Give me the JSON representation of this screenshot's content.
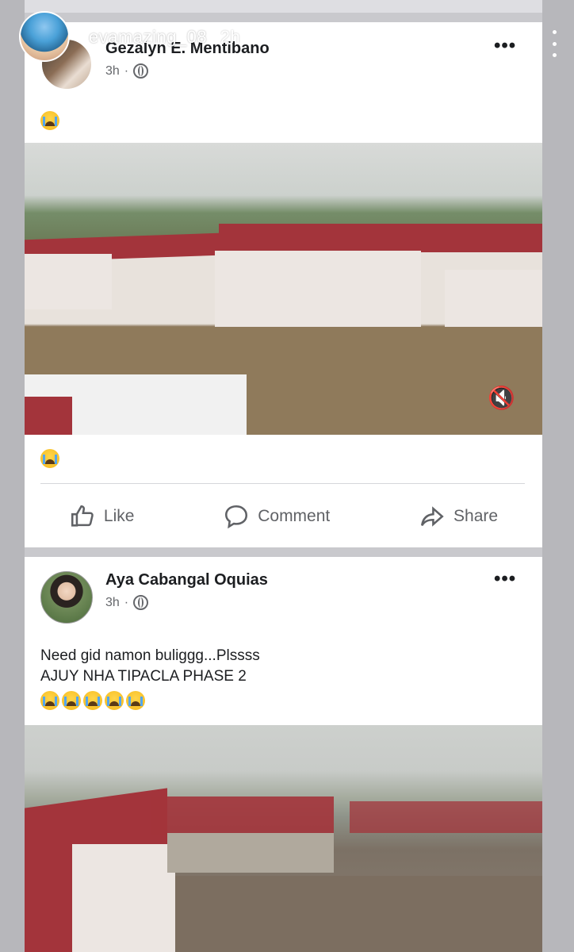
{
  "story": {
    "username": "evamazing_08",
    "age": "2h",
    "avatar_icon": "profile-avatar"
  },
  "posts": [
    {
      "author": "Gezalyn E. Mentibano",
      "time": "3h",
      "text_lines": [],
      "emoji_line": "cry",
      "media": "flood-video",
      "reaction": "sad",
      "actions": {
        "like": "Like",
        "comment": "Comment",
        "share": "Share"
      }
    },
    {
      "author": "Aya Cabangal Oquias",
      "time": "3h",
      "text_lines": [
        "Need gid namon buliggg...Plssss",
        "AJUY NHA TIPACLA PHASE 2"
      ],
      "emoji_line": "cry x5",
      "media": "flood-photo"
    }
  ],
  "colors": {
    "accent": "#1877f2",
    "text": "#1c1e21",
    "muted": "#65676b",
    "flood_roof": "#a3343b"
  }
}
